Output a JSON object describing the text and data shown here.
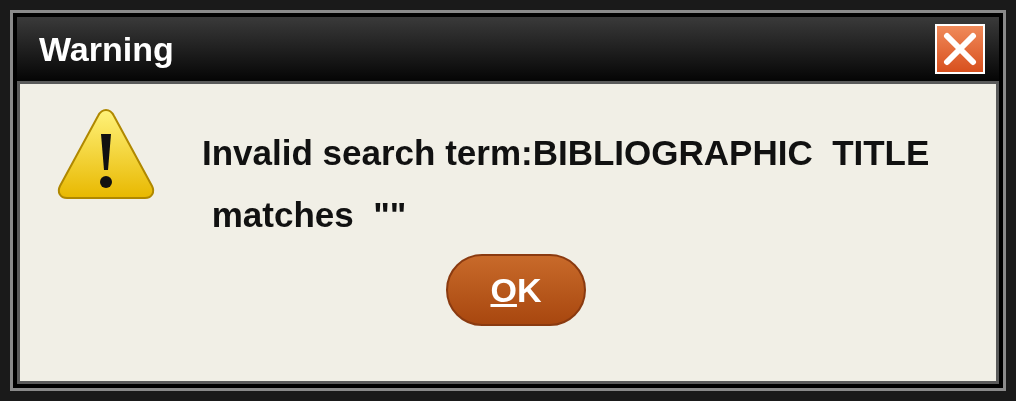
{
  "window": {
    "title": "Warning"
  },
  "message": "Invalid search term:BIBLIOGRAPHIC  TITLE\n matches  \"\"",
  "buttons": [
    {
      "label": "OK"
    }
  ]
}
